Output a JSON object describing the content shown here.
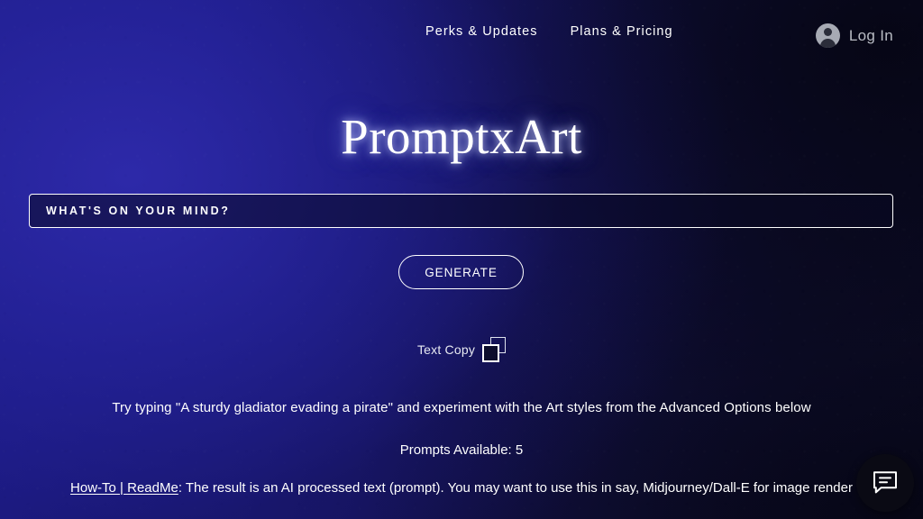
{
  "header": {
    "nav_links": [
      {
        "label": "Perks & Updates",
        "name": "nav-link-perks-updates"
      },
      {
        "label": "Plans & Pricing",
        "name": "nav-link-plans-pricing"
      }
    ],
    "login_label": "Log In",
    "avatar_icon": "user-avatar-icon"
  },
  "hero": {
    "title": "PromptxArt"
  },
  "prompt": {
    "placeholder": "WHAT'S ON YOUR MIND?",
    "value": "",
    "generate_label": "GENERATE"
  },
  "copy": {
    "label": "Text Copy",
    "icon": "copy-icon"
  },
  "info": {
    "hint": "Try typing \"A sturdy gladiator evading a pirate\" and experiment with the Art styles from the Advanced Options below",
    "prompts_available": "Prompts Available: 5",
    "readme_link": "How-To | ReadMe",
    "readme_rest": ": The result is an AI processed text (prompt). You may want to use this in say, Midjourney/Dall-E for image render"
  },
  "chat": {
    "icon": "chat-bubble-icon"
  },
  "colors": {
    "background_left": "#24219b",
    "background_right": "#09091c",
    "text_primary": "#ffffff",
    "login_text": "#b9bcc4",
    "chat_button": "#0a0a14"
  }
}
